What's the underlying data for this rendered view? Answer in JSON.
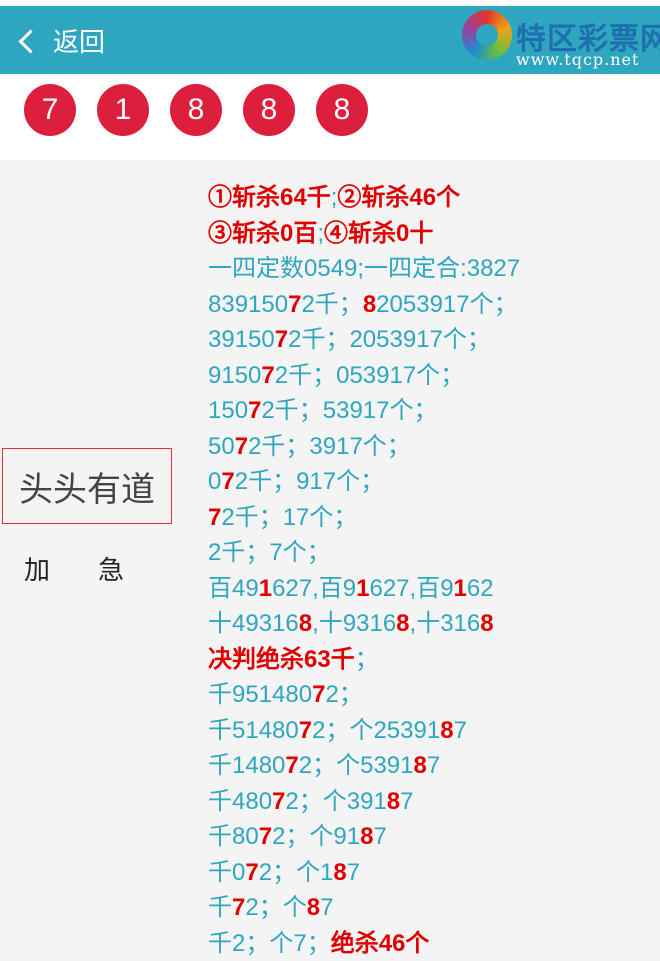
{
  "header": {
    "back_label": "返回",
    "brand": "特区彩票网",
    "url": "www.tqcp.net"
  },
  "balls": [
    "7",
    "1",
    "8",
    "8",
    "8"
  ],
  "sidebar": {
    "title": "头头有道",
    "subtitle": "加急"
  },
  "lines": [
    [
      [
        "①斩杀64千",
        1
      ],
      [
        ";",
        0
      ],
      [
        "②斩杀46个",
        1
      ]
    ],
    [
      [
        "③斩杀0百",
        1
      ],
      [
        ";",
        0
      ],
      [
        "④斩杀0十",
        1
      ]
    ],
    [
      [
        "一四定数0549;一四定合:3827",
        0
      ]
    ],
    [
      [
        "839150",
        0
      ],
      [
        "7",
        1
      ],
      [
        "2千；",
        0
      ],
      [
        "8",
        1
      ],
      [
        "2053917个；",
        0
      ]
    ],
    [
      [
        "39150",
        0
      ],
      [
        "7",
        1
      ],
      [
        "2千；2053917个；",
        0
      ]
    ],
    [
      [
        "9150",
        0
      ],
      [
        "7",
        1
      ],
      [
        "2千；053917个；",
        0
      ]
    ],
    [
      [
        "150",
        0
      ],
      [
        "7",
        1
      ],
      [
        "2千；53917个；",
        0
      ]
    ],
    [
      [
        "50",
        0
      ],
      [
        "7",
        1
      ],
      [
        "2千；3917个；",
        0
      ]
    ],
    [
      [
        "0",
        0
      ],
      [
        "7",
        1
      ],
      [
        "2千；917个；",
        0
      ]
    ],
    [
      [
        "7",
        1
      ],
      [
        "2千；17个；",
        0
      ]
    ],
    [
      [
        "2千；7个；",
        0
      ]
    ],
    [
      [
        "百49",
        0
      ],
      [
        "1",
        1
      ],
      [
        "627,百9",
        0
      ],
      [
        "1",
        1
      ],
      [
        "627,百9",
        0
      ],
      [
        "1",
        1
      ],
      [
        "62",
        0
      ]
    ],
    [
      [
        "十49316",
        0
      ],
      [
        "8",
        1
      ],
      [
        ",十9316",
        0
      ],
      [
        "8",
        1
      ],
      [
        ",十316",
        0
      ],
      [
        "8",
        1
      ]
    ],
    [
      [
        "决判绝杀63千",
        1
      ],
      [
        "；",
        0
      ]
    ],
    [
      [
        "千951480",
        0
      ],
      [
        "7",
        1
      ],
      [
        "2；",
        0
      ]
    ],
    [
      [
        "千51480",
        0
      ],
      [
        "7",
        1
      ],
      [
        "2；个25391",
        0
      ],
      [
        "8",
        1
      ],
      [
        "7",
        0
      ]
    ],
    [
      [
        "千1480",
        0
      ],
      [
        "7",
        1
      ],
      [
        "2；个5391",
        0
      ],
      [
        "8",
        1
      ],
      [
        "7",
        0
      ]
    ],
    [
      [
        "千480",
        0
      ],
      [
        "7",
        1
      ],
      [
        "2；个391",
        0
      ],
      [
        "8",
        1
      ],
      [
        "7",
        0
      ]
    ],
    [
      [
        "千80",
        0
      ],
      [
        "7",
        1
      ],
      [
        "2；个91",
        0
      ],
      [
        "8",
        1
      ],
      [
        "7",
        0
      ]
    ],
    [
      [
        "千0",
        0
      ],
      [
        "7",
        1
      ],
      [
        "2；个1",
        0
      ],
      [
        "8",
        1
      ],
      [
        "7",
        0
      ]
    ],
    [
      [
        "千",
        0
      ],
      [
        "7",
        1
      ],
      [
        "2；个",
        0
      ],
      [
        "8",
        1
      ],
      [
        "7",
        0
      ]
    ],
    [
      [
        "千2；个7；",
        0
      ],
      [
        "绝杀46个",
        1
      ]
    ]
  ]
}
